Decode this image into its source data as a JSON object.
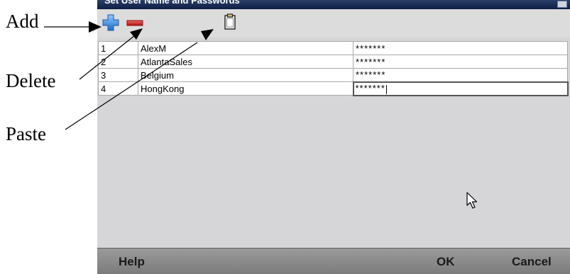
{
  "annotations": {
    "add": "Add",
    "delete": "Delete",
    "paste": "Paste"
  },
  "dialog": {
    "title": "Set User Name and Passwords"
  },
  "toolbar": {
    "add_icon": "plus-icon",
    "delete_icon": "minus-icon",
    "paste_icon": "clipboard-icon"
  },
  "table": {
    "rows": [
      {
        "index": "1",
        "user": "AlexM",
        "password": "*******"
      },
      {
        "index": "2",
        "user": "AtlantaSales",
        "password": "*******"
      },
      {
        "index": "3",
        "user": "Belgium",
        "password": "*******"
      },
      {
        "index": "4",
        "user": "HongKong",
        "password": "*******"
      }
    ]
  },
  "footer": {
    "help_label": "Help",
    "ok_label": "OK",
    "cancel_label": "Cancel"
  },
  "colors": {
    "add_icon": "#3a8fdc",
    "delete_icon": "#d21c1c",
    "titlebar": "#1a2c55"
  }
}
